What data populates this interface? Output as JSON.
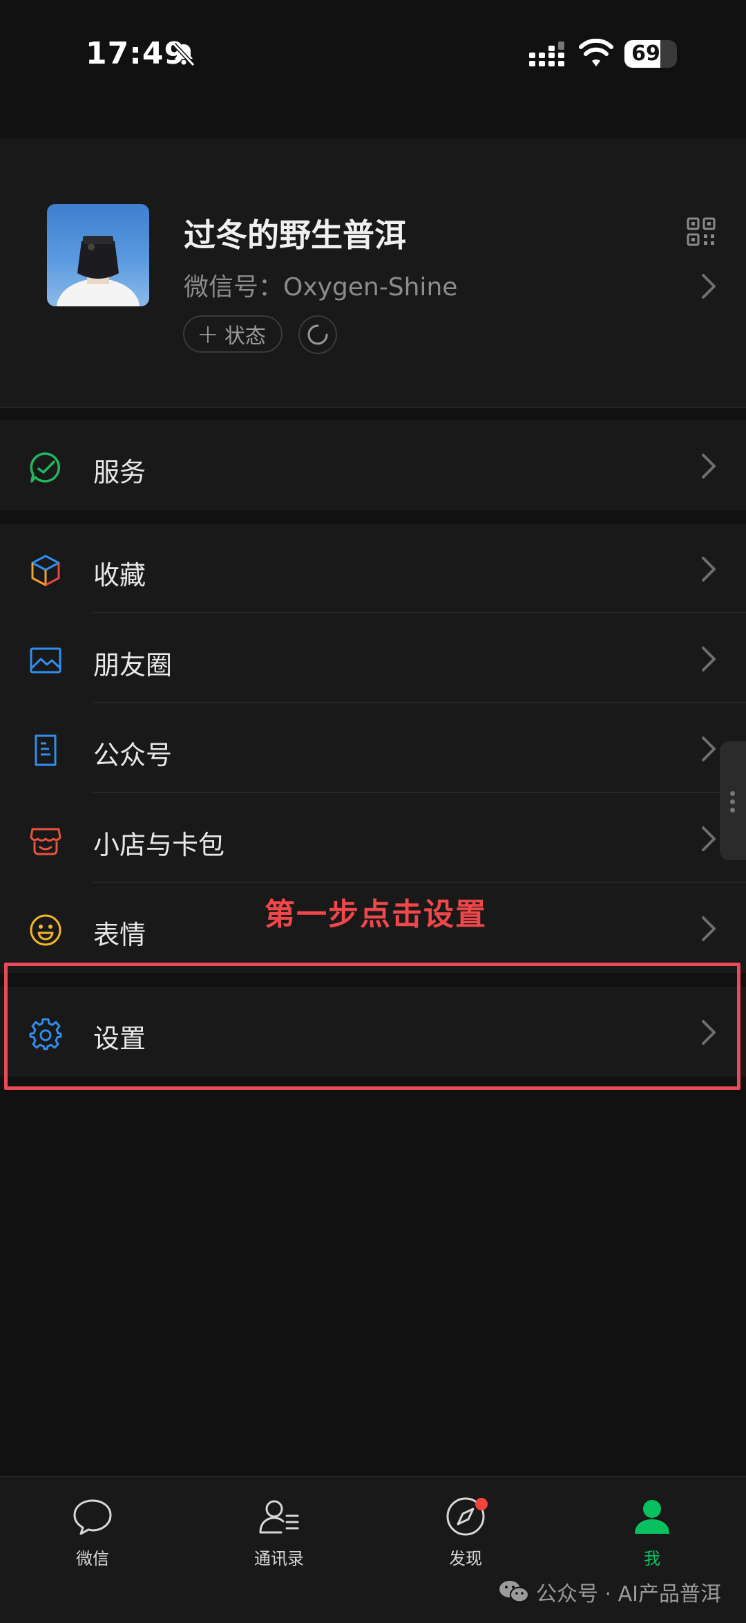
{
  "status_bar": {
    "time": "17:49",
    "battery": "69",
    "battery_level": 0.69
  },
  "profile": {
    "nickname": "过冬的野生普洱",
    "wechat_id_label": "微信号：",
    "wechat_id": "Oxygen-Shine",
    "status_button": "状态"
  },
  "menu": {
    "services": "服务",
    "favorites": "收藏",
    "moments": "朋友圈",
    "official_accounts": "公众号",
    "shop_cards": "小店与卡包",
    "stickers": "表情",
    "settings": "设置"
  },
  "annotation": "第一步点击设置",
  "tabbar": {
    "chats": "微信",
    "contacts": "通讯录",
    "discover": "发现",
    "me": "我"
  },
  "watermark": "公众号 · AI产品普洱",
  "colors": {
    "accent_green": "#07c160",
    "annotation_red": "#f0474a",
    "background": "#111111"
  }
}
